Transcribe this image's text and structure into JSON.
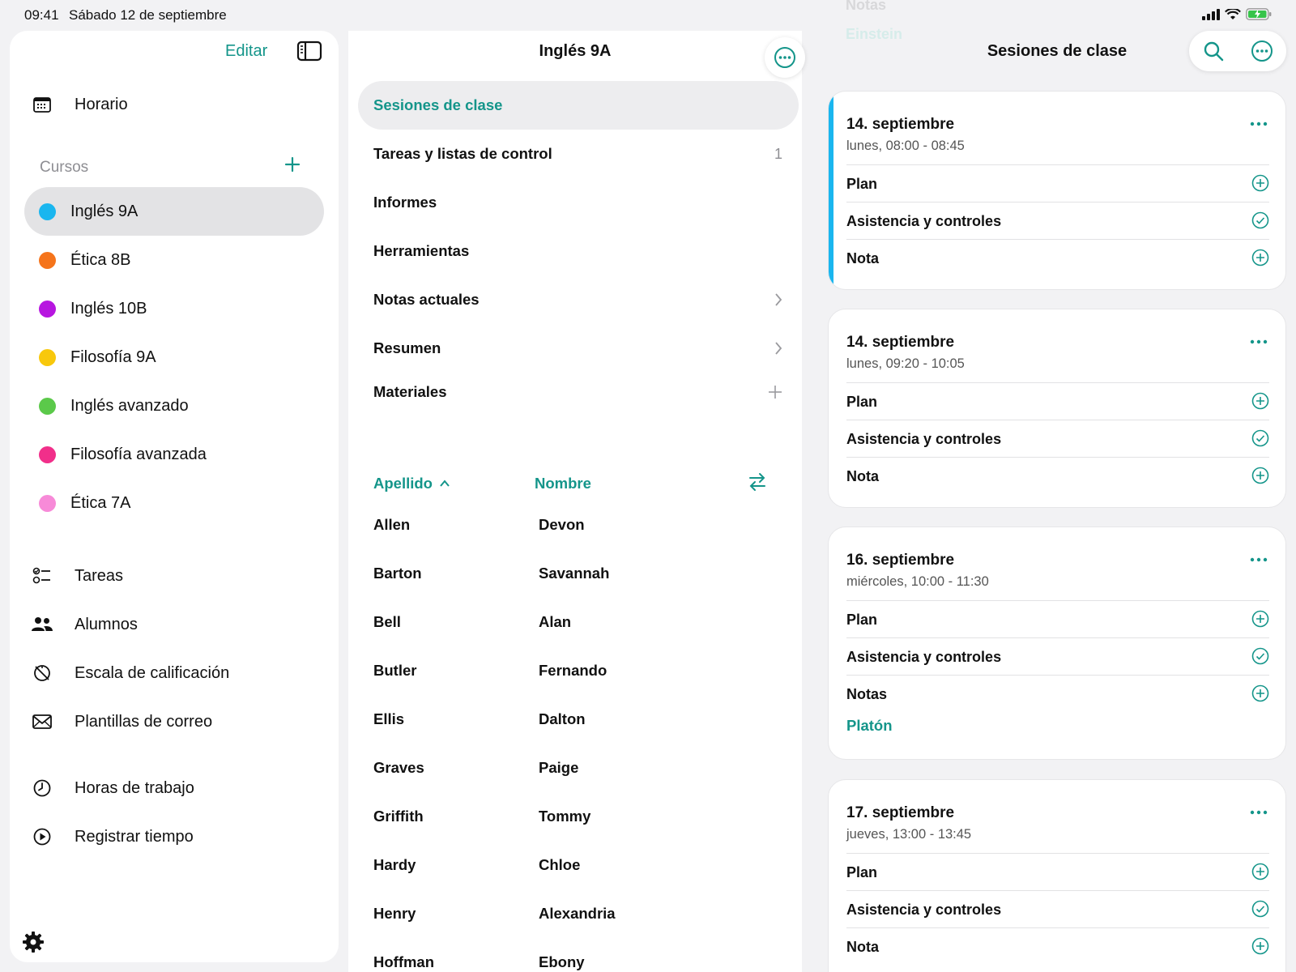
{
  "status": {
    "time": "09:41",
    "date": "Sábado 12 de septiembre"
  },
  "sidebar": {
    "edit": "Editar",
    "top": [
      {
        "label": "Horario",
        "icon": "calendar-icon"
      }
    ],
    "section": "Cursos",
    "courses": [
      {
        "label": "Inglés 9A",
        "color": "#1ab6ef",
        "active": true
      },
      {
        "label": "Ética 8B",
        "color": "#f5741b"
      },
      {
        "label": "Inglés 10B",
        "color": "#b716e0"
      },
      {
        "label": "Filosofía 9A",
        "color": "#f8c80c"
      },
      {
        "label": "Inglés avanzado",
        "color": "#5bc94a"
      },
      {
        "label": "Filosofía avanzada",
        "color": "#f12f8a"
      },
      {
        "label": "Ética 7A",
        "color": "#f78ad8"
      }
    ],
    "tools": [
      {
        "label": "Tareas",
        "icon": "checklist-icon"
      },
      {
        "label": "Alumnos",
        "icon": "people-icon"
      },
      {
        "label": "Escala de calificación",
        "icon": "grading-scale-icon"
      },
      {
        "label": "Plantillas de correo",
        "icon": "envelope-icon"
      }
    ],
    "time": [
      {
        "label": "Horas de trabajo",
        "icon": "clock-icon"
      },
      {
        "label": "Registrar tiempo",
        "icon": "play-circle-icon"
      }
    ]
  },
  "middle": {
    "title": "Inglés 9A",
    "menu": [
      {
        "label": "Sesiones de clase",
        "active": true,
        "trail": ""
      },
      {
        "label": "Tareas y listas de control",
        "trail": "1"
      },
      {
        "label": "Informes",
        "trail": ""
      },
      {
        "label": "Herramientas",
        "trail": ""
      },
      {
        "label": "Notas actuales",
        "trail": "chevron"
      },
      {
        "label": "Resumen",
        "trail": "chevron"
      },
      {
        "label": "Materiales",
        "trail": "plus"
      }
    ],
    "sort": {
      "last": "Apellido",
      "first": "Nombre"
    },
    "students": [
      {
        "last": "Allen",
        "first": "Devon"
      },
      {
        "last": "Barton",
        "first": "Savannah"
      },
      {
        "last": "Bell",
        "first": "Alan"
      },
      {
        "last": "Butler",
        "first": "Fernando"
      },
      {
        "last": "Ellis",
        "first": "Dalton"
      },
      {
        "last": "Graves",
        "first": "Paige"
      },
      {
        "last": "Griffith",
        "first": "Tommy"
      },
      {
        "last": "Hardy",
        "first": "Chloe"
      },
      {
        "last": "Henry",
        "first": "Alexandria"
      },
      {
        "last": "Hoffman",
        "first": "Ebony"
      }
    ]
  },
  "right": {
    "ghost": "Notas",
    "ghost_link": "Einstein",
    "title": "Sesiones de clase",
    "sessions": [
      {
        "date": "14. septiembre",
        "time": "lunes, 08:00 - 08:45",
        "current": true,
        "rows": [
          {
            "label": "Plan",
            "icon": "plus"
          },
          {
            "label": "Asistencia y controles",
            "icon": "check"
          },
          {
            "label": "Nota",
            "icon": "plus"
          }
        ],
        "link": ""
      },
      {
        "date": "14. septiembre",
        "time": "lunes, 09:20 - 10:05",
        "rows": [
          {
            "label": "Plan",
            "icon": "plus"
          },
          {
            "label": "Asistencia y controles",
            "icon": "check"
          },
          {
            "label": "Nota",
            "icon": "plus"
          }
        ],
        "link": ""
      },
      {
        "date": "16. septiembre",
        "time": "miércoles, 10:00 - 11:30",
        "rows": [
          {
            "label": "Plan",
            "icon": "plus"
          },
          {
            "label": "Asistencia y controles",
            "icon": "check"
          },
          {
            "label": "Notas",
            "icon": "plus"
          }
        ],
        "link": "Platón"
      },
      {
        "date": "17. septiembre",
        "time": "jueves, 13:00 - 13:45",
        "rows": [
          {
            "label": "Plan",
            "icon": "plus"
          },
          {
            "label": "Asistencia y controles",
            "icon": "check"
          },
          {
            "label": "Nota",
            "icon": "plus"
          }
        ],
        "link": ""
      }
    ]
  },
  "colors": {
    "accent": "#14958a",
    "current": "#1ab6ef"
  }
}
